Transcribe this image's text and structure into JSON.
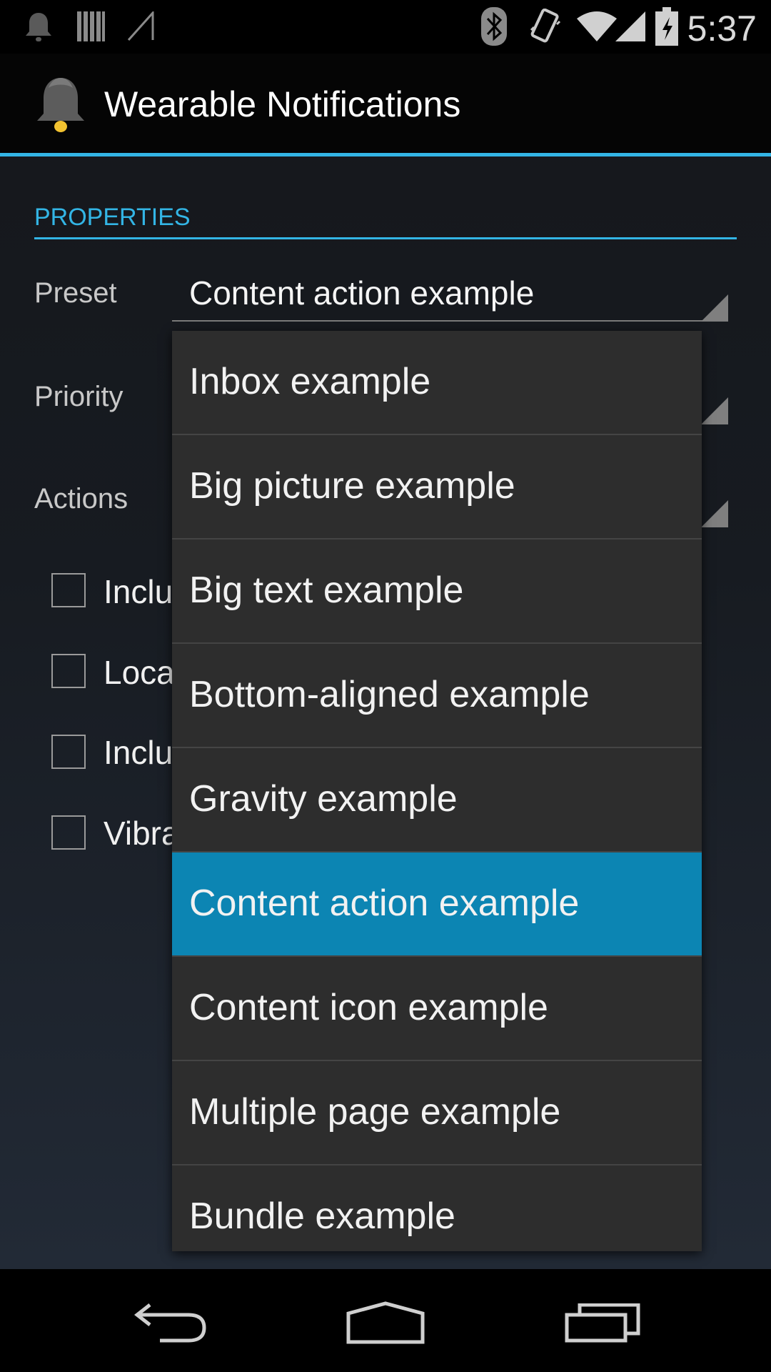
{
  "status_bar": {
    "time": "5:37",
    "icons": [
      "notification-bell-icon",
      "barcode-icon",
      "signal-slash-icon",
      "bluetooth-icon",
      "vibrate-icon",
      "wifi-icon",
      "cell-signal-icon",
      "battery-charging-icon"
    ]
  },
  "action_bar": {
    "title": "Wearable Notifications",
    "icon": "bell-icon",
    "accent_color": "#33b5e5"
  },
  "properties": {
    "header": "PROPERTIES",
    "preset_label": "Preset",
    "preset_value": "Content action example",
    "priority_label": "Priority",
    "actions_label": "Actions",
    "checkboxes": [
      {
        "label": "Inclu",
        "checked": false
      },
      {
        "label": "Loca",
        "checked": false
      },
      {
        "label": "Inclu",
        "checked": false
      },
      {
        "label": "Vibra",
        "checked": false
      }
    ]
  },
  "dropdown": {
    "items": [
      "Inbox example",
      "Big picture example",
      "Big text example",
      "Bottom-aligned example",
      "Gravity example",
      "Content action example",
      "Content icon example",
      "Multiple page example",
      "Bundle example"
    ],
    "selected": "Content action example",
    "selected_color": "#0c85b3"
  },
  "nav_bar": {
    "icons": [
      "back-icon",
      "home-icon",
      "recent-apps-icon"
    ]
  }
}
